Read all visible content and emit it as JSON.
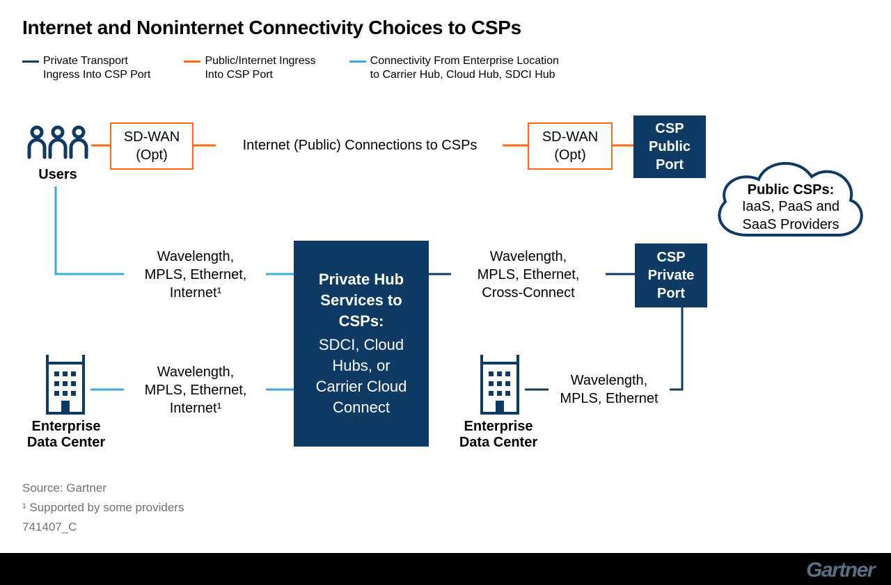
{
  "title": "Internet and Noninternet Connectivity Choices to CSPs",
  "colors": {
    "navy": "#0F3A63",
    "orange": "#F9690E",
    "lightblue": "#3CA9E0",
    "text_muted": "#707070"
  },
  "legend": [
    {
      "label": "Private Transport\nIngress Into CSP Port",
      "color_key": "navy"
    },
    {
      "label": "Public/Internet Ingress\nInto CSP Port",
      "color_key": "orange"
    },
    {
      "label": "Connectivity From Enterprise Location\nto Carrier Hub, Cloud Hub, SDCI Hub",
      "color_key": "lightblue"
    }
  ],
  "nodes": {
    "users_label": "Users",
    "sdwan1": "SD-WAN\n(Opt)",
    "internet_public": "Internet (Public) Connections to CSPs",
    "sdwan2": "SD-WAN\n(Opt)",
    "csp_public_port": "CSP\nPublic\nPort",
    "cloud_title": "Public CSPs:",
    "cloud_body": "IaaS, PaaS and\nSaaS Providers",
    "wl1": "Wavelength,\nMPLS, Ethernet,\nInternet¹",
    "wl2": "Wavelength,\nMPLS, Ethernet,\nInternet¹",
    "wl3": "Wavelength,\nMPLS, Ethernet,\nCross-Connect",
    "wl4": "Wavelength,\nMPLS, Ethernet",
    "private_hub_title": "Private Hub\nServices to\nCSPs:",
    "private_hub_body": "SDCI, Cloud\nHubs, or\nCarrier Cloud\nConnect",
    "csp_private_port": "CSP\nPrivate\nPort",
    "edc": "Enterprise\nData Center"
  },
  "footnotes": {
    "source": "Source: Gartner",
    "note1": "¹ Supported by some providers",
    "id": "741407_C"
  },
  "brand": "Gartner"
}
